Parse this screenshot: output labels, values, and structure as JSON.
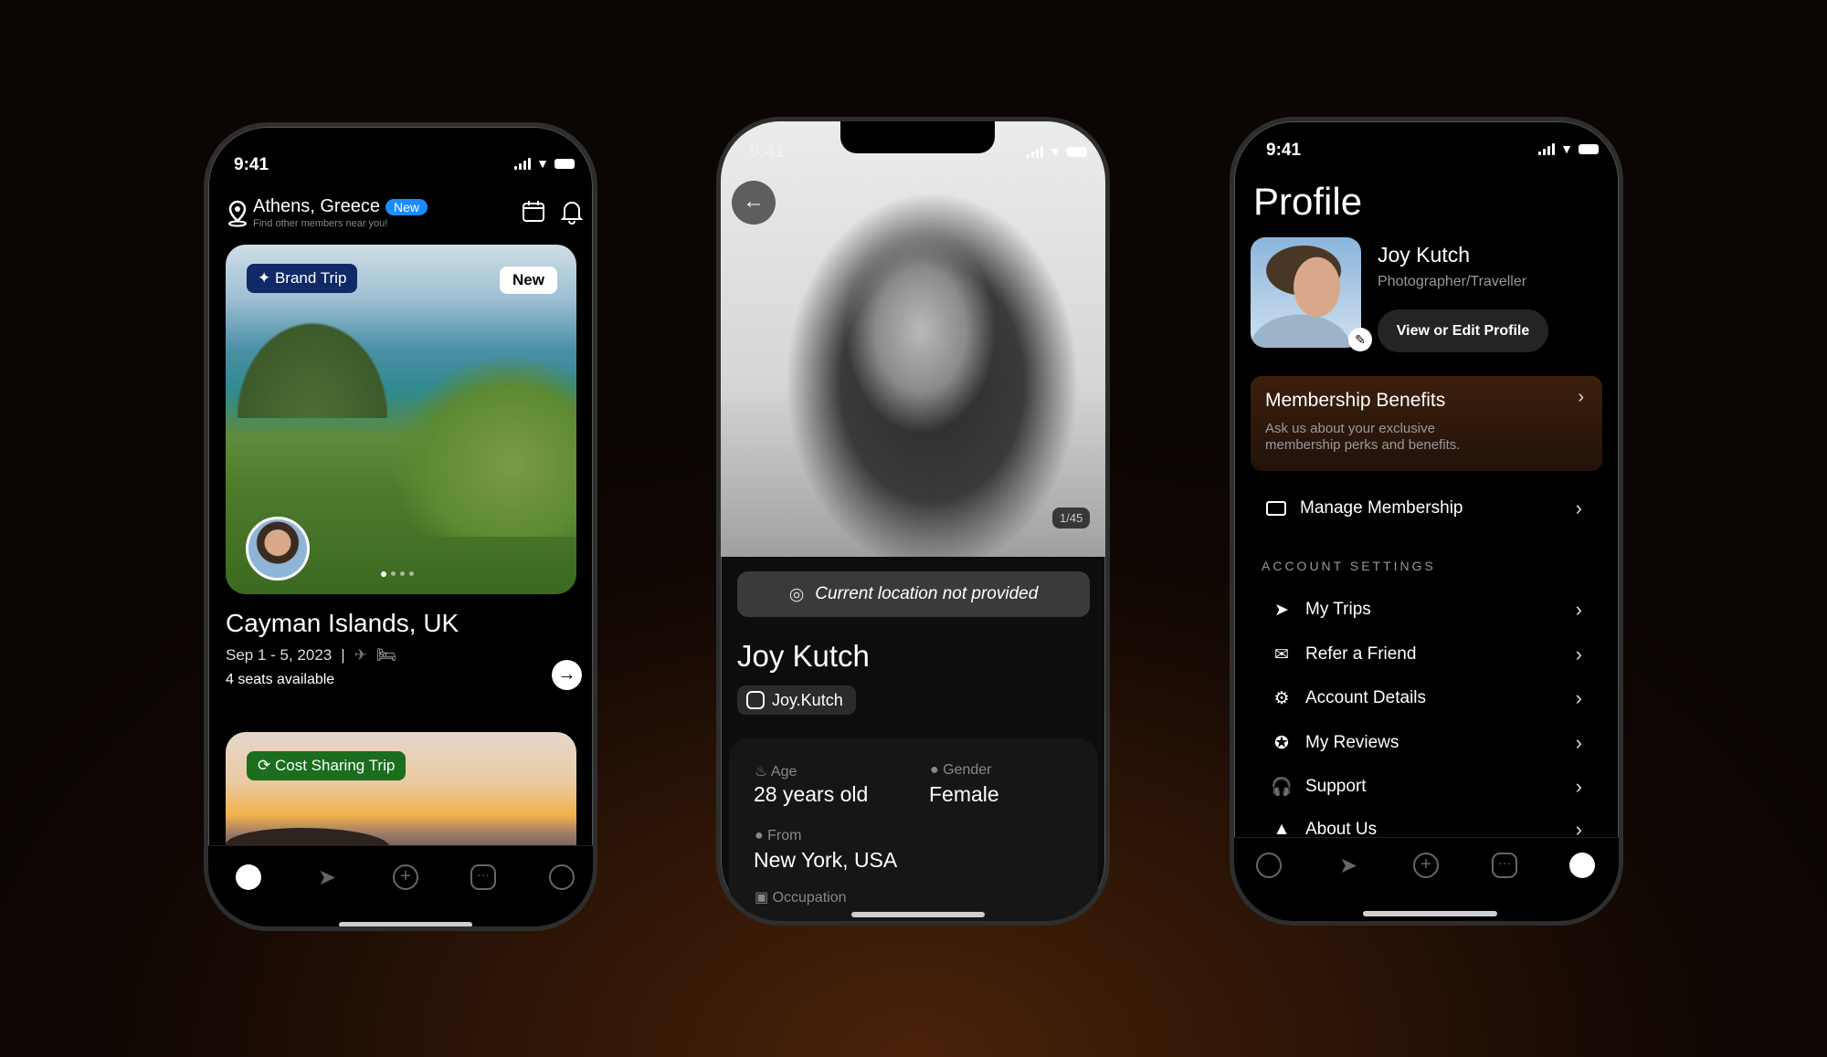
{
  "status": {
    "time": "9:41"
  },
  "explore": {
    "location": "Athens, Greece",
    "location_badge": "New",
    "location_sub": "Find other members near you!",
    "trips": [
      {
        "tag": "Brand Trip",
        "badge": "New",
        "title": "Cayman Islands, UK",
        "dates": "Sep 1 - 5, 2023",
        "separator": "|",
        "seats": "4 seats available",
        "carousel_pages": 4,
        "carousel_active": 1
      },
      {
        "tag": "Cost Sharing Trip"
      }
    ],
    "active_tab": "explore"
  },
  "member": {
    "photo_counter": "1/45",
    "location_notice": "Current location not provided",
    "name": "Joy Kutch",
    "instagram": "Joy.Kutch",
    "fields": {
      "age_label": "Age",
      "age": "28 years old",
      "gender_label": "Gender",
      "gender": "Female",
      "from_label": "From",
      "from": "New York, USA",
      "occupation_label": "Occupation"
    }
  },
  "profile": {
    "title": "Profile",
    "name": "Joy Kutch",
    "role": "Photographer/Traveller",
    "edit_button": "View or Edit Profile",
    "membership": {
      "title": "Membership Benefits",
      "desc1": "Ask us about your exclusive",
      "desc2": "membership perks and benefits."
    },
    "manage": "Manage Membership",
    "section": "ACCOUNT SETTINGS",
    "items": [
      "My Trips",
      "Refer a Friend",
      "Account Details",
      "My Reviews",
      "Support",
      "About Us"
    ],
    "active_tab": "profile"
  },
  "colors": {
    "blue_badge": "#1a8cff",
    "brand_badge": "#0f2a66",
    "cost_badge": "#1b6e1e",
    "membership_card": "#3a1d0c"
  }
}
